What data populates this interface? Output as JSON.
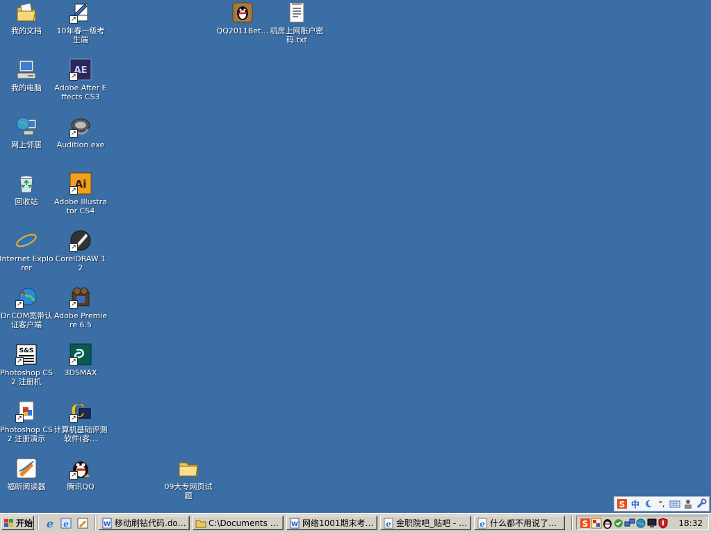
{
  "desktop": {
    "background_color": "#3a6ea5",
    "icons": [
      {
        "label": "我的文档",
        "icon": "my-documents-icon",
        "shortcut": false
      },
      {
        "label": "10年春一级考生端",
        "icon": "exam-client-icon",
        "shortcut": true
      },
      {
        "label": "QQ2011Bet…",
        "icon": "qq-installer-icon",
        "shortcut": false
      },
      {
        "label": "机房上网账户密码.txt",
        "icon": "text-file-icon",
        "shortcut": false
      },
      {
        "label": "我的电脑",
        "icon": "my-computer-icon",
        "shortcut": false
      },
      {
        "label": "Adobe After Effects CS3",
        "icon": "after-effects-icon",
        "shortcut": true
      },
      {
        "label": "网上邻居",
        "icon": "network-places-icon",
        "shortcut": false
      },
      {
        "label": "Audition.exe",
        "icon": "audition-icon",
        "shortcut": true
      },
      {
        "label": "回收站",
        "icon": "recycle-bin-icon",
        "shortcut": false
      },
      {
        "label": "Adobe Illustrator CS4",
        "icon": "illustrator-icon",
        "shortcut": true
      },
      {
        "label": "Internet Explorer",
        "icon": "internet-explorer-icon",
        "shortcut": false
      },
      {
        "label": "CorelDRAW 12",
        "icon": "coreldraw-icon",
        "shortcut": true
      },
      {
        "label": "Dr.COM宽带认证客户端",
        "icon": "drcom-icon",
        "shortcut": true
      },
      {
        "label": "Adobe Premiere 6.5",
        "icon": "premiere-icon",
        "shortcut": true
      },
      {
        "label": "Photoshop CS2 注册机",
        "icon": "keygen-icon",
        "shortcut": true
      },
      {
        "label": "3DSMAX",
        "icon": "3dsmax-icon",
        "shortcut": true
      },
      {
        "label": "Photoshop CS2 注册演示",
        "icon": "demo-icon",
        "shortcut": true
      },
      {
        "label": "计算机基础评测软件(客…",
        "icon": "assessment-software-icon",
        "shortcut": true
      },
      {
        "label": "福昕阅读器",
        "icon": "foxit-reader-icon",
        "shortcut": false
      },
      {
        "label": "腾讯QQ",
        "icon": "qq-icon",
        "shortcut": true
      },
      {
        "label": "09大专网页试题",
        "icon": "folder-icon",
        "shortcut": false
      }
    ]
  },
  "ime_toolbar": {
    "items": [
      "sogou-s-icon",
      "中",
      "moon-icon",
      "°,",
      "keyboard-icon",
      "skin-icon",
      "wrench-icon"
    ]
  },
  "taskbar": {
    "start_label": "开始",
    "quick_launch": [
      "ie-quicklaunch-icon",
      "ie-alt-quicklaunch-icon",
      "foxit-quicklaunch-icon"
    ],
    "tasks": [
      {
        "label": "移动刷钻代码.do…",
        "icon": "word-doc-icon"
      },
      {
        "label": "C:\\Documents and …",
        "icon": "folder-icon"
      },
      {
        "label": "网络1001期末考…",
        "icon": "word-doc-icon"
      },
      {
        "label": "金职院吧_贴吧 - …",
        "icon": "ie-page-icon"
      },
      {
        "label": "什么都不用说了…",
        "icon": "ie-page-icon"
      }
    ],
    "tray_icons": [
      "sogou-tray-icon",
      "ime-tray-icon",
      "qq-tray-icon",
      "antivirus-tray-icon",
      "network-tray-icon",
      "globe-tray-icon",
      "monitor-tray-icon",
      "shield-tray-icon"
    ],
    "clock": "18:32"
  }
}
